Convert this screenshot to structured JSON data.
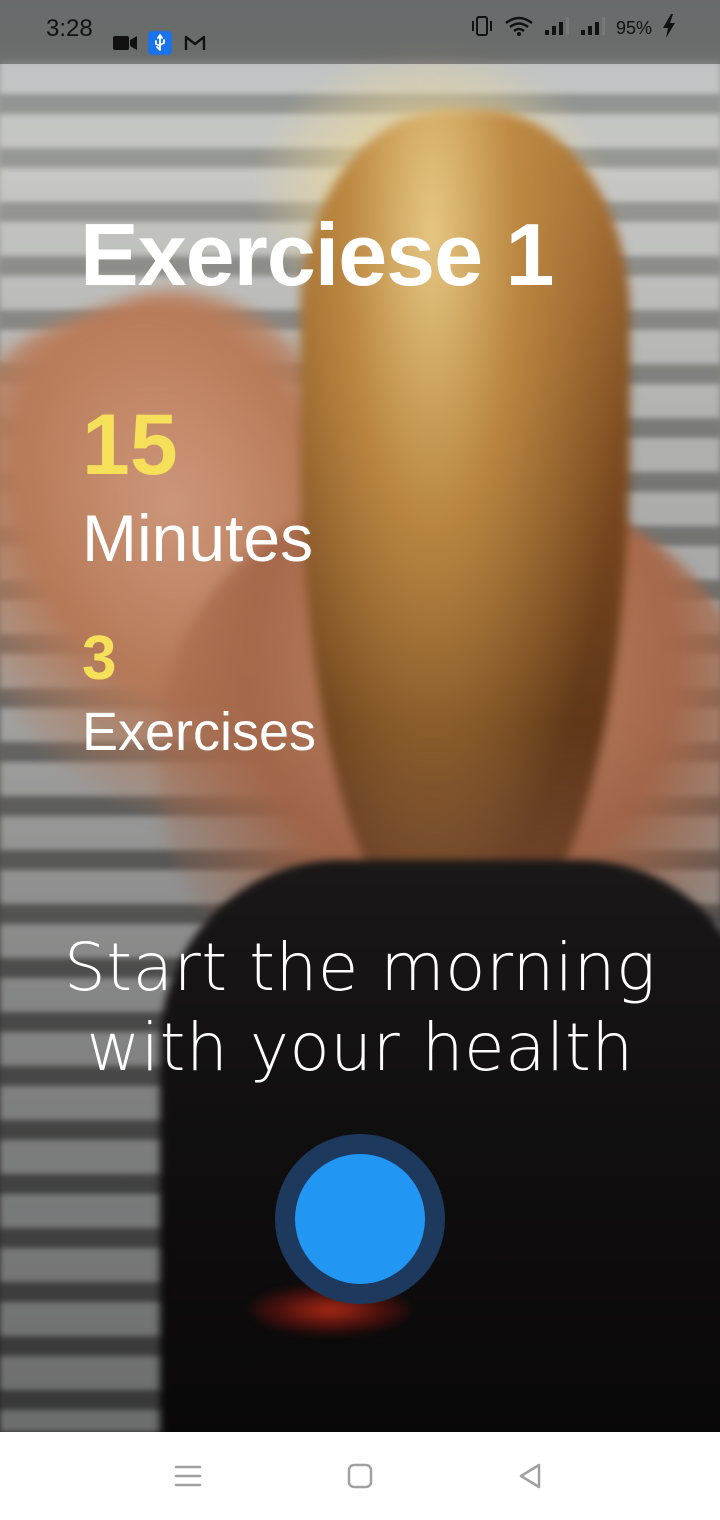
{
  "status_bar": {
    "time": "3:28",
    "left_icons": [
      "video-camera-icon",
      "usb-icon",
      "gmail-icon"
    ],
    "right_icons": [
      "vibrate-icon",
      "wifi-icon",
      "signal-icon",
      "signal-icon"
    ],
    "battery": "95%"
  },
  "workout": {
    "title": "Exerciese 1",
    "duration_value": "15",
    "duration_label": "Minutes",
    "exercises_value": "3",
    "exercises_label": "Exercises",
    "tagline_line1": "Start the morning",
    "tagline_line2": "with your health"
  },
  "colors": {
    "accent_yellow": "#f6e05a",
    "button_blue": "#2196f3",
    "button_ring": "#1d3a5e"
  },
  "nav_bar": {
    "buttons": [
      "menu-icon",
      "home-icon",
      "back-icon"
    ]
  }
}
